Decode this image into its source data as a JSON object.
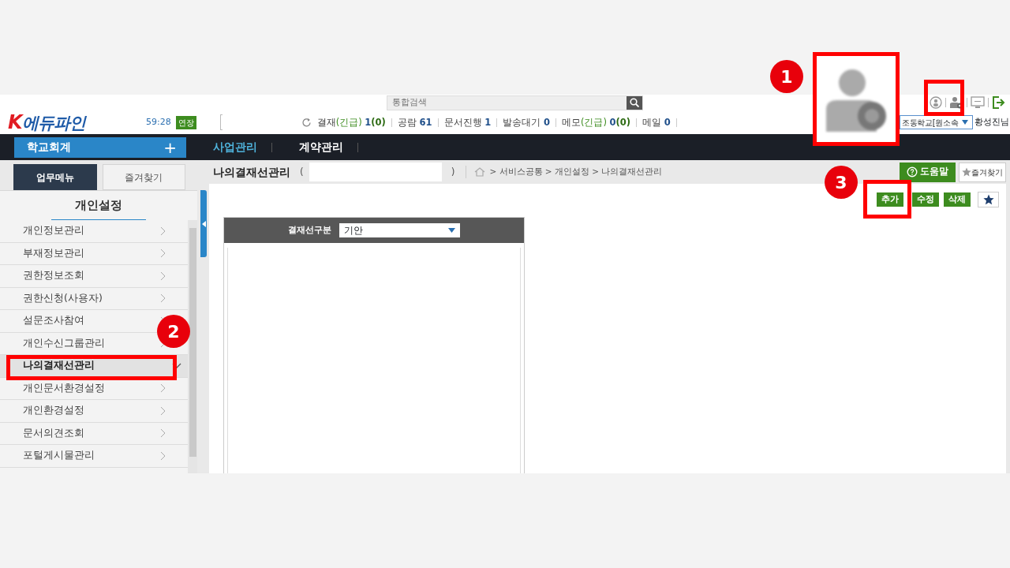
{
  "header": {
    "search": {
      "placeholder": "통합검색"
    },
    "logo": {
      "mark": "K",
      "name": "에듀파인"
    },
    "timer": "59:28",
    "extend_button": "연장",
    "counters": [
      {
        "label": "결재",
        "urgent": "(긴급)",
        "count": "1",
        "urgent_count": "(0)"
      },
      {
        "label": "공람",
        "count": "61"
      },
      {
        "label": "문서진행",
        "count": "1"
      },
      {
        "label": "발송대기",
        "count": "0"
      },
      {
        "label": "메모",
        "urgent": "(긴급)",
        "count": "0",
        "urgent_count": "(0)"
      },
      {
        "label": "메일",
        "count": "0"
      }
    ],
    "org_select": "조동학교[원소속",
    "user_name": "황성진님"
  },
  "nav": {
    "module_button": "학교회계",
    "add_symbol": "+",
    "menus": [
      {
        "label": "사업관리",
        "selected": true
      },
      {
        "label": "계약관리",
        "selected": false
      }
    ]
  },
  "sidebar": {
    "tabs": [
      {
        "label": "업무메뉴",
        "selected": true
      },
      {
        "label": "즐겨찾기",
        "selected": false
      }
    ],
    "title": "개인설정",
    "items": [
      {
        "label": "개인정보관리",
        "selected": false
      },
      {
        "label": "부재정보관리",
        "selected": false
      },
      {
        "label": "권한정보조회",
        "selected": false
      },
      {
        "label": "권한신청(사용자)",
        "selected": false
      },
      {
        "label": "설문조사참여",
        "selected": false
      },
      {
        "label": "개인수신그룹관리",
        "selected": false
      },
      {
        "label": "나의결재선관리",
        "selected": true
      },
      {
        "label": "개인문서환경설정",
        "selected": false
      },
      {
        "label": "개인환경설정",
        "selected": false
      },
      {
        "label": "문서의견조회",
        "selected": false
      },
      {
        "label": "포털게시물관리",
        "selected": false
      }
    ]
  },
  "main": {
    "title": "나의결재선관리",
    "paren_open": "(",
    "paren_close": ")",
    "breadcrumb": "> 서비스공통 > 개인설정 > 나의결재선관리",
    "help_button": "도움말",
    "favorite_button": "즐겨찾기",
    "actions": [
      "추가",
      "수정",
      "삭제"
    ],
    "panel": {
      "label": "결재선구분",
      "value": "기안"
    }
  },
  "annotations": [
    {
      "number": "1"
    },
    {
      "number": "2"
    },
    {
      "number": "3"
    }
  ]
}
